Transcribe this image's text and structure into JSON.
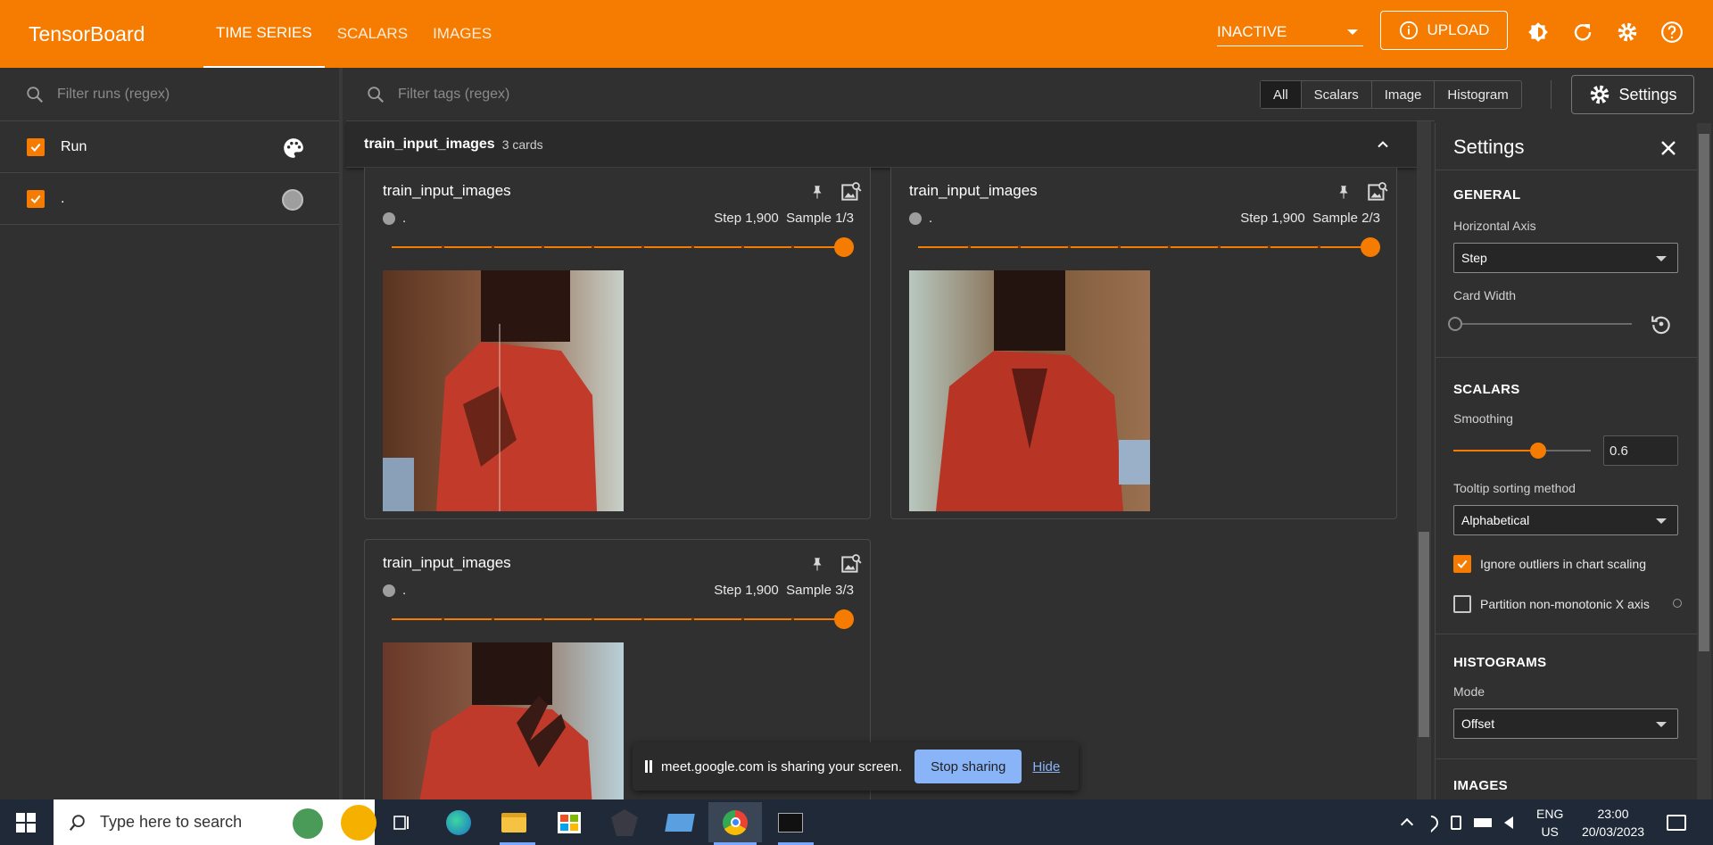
{
  "app": {
    "brand": "TensorBoard",
    "tabs": [
      "TIME SERIES",
      "SCALARS",
      "IMAGES"
    ],
    "active_tab": "TIME SERIES",
    "status_select": "INACTIVE",
    "upload_label": "UPLOAD",
    "accent_color": "#f57c00"
  },
  "left": {
    "filter_placeholder": "Filter runs (regex)",
    "runs": [
      {
        "label": "Run",
        "checked": true,
        "icon": "palette-icon"
      },
      {
        "label": ".",
        "checked": true,
        "icon": "color-dot-icon"
      }
    ]
  },
  "main": {
    "tag_filter_placeholder": "Filter tags (regex)",
    "chips": [
      "All",
      "Scalars",
      "Image",
      "Histogram"
    ],
    "active_chip": "All",
    "settings_button": "Settings",
    "group": {
      "title": "train_input_images",
      "count": "3 cards"
    },
    "cards": [
      {
        "title": "train_input_images",
        "run": ".",
        "step": "Step 1,900",
        "sample": "Sample 1/3"
      },
      {
        "title": "train_input_images",
        "run": ".",
        "step": "Step 1,900",
        "sample": "Sample 2/3"
      },
      {
        "title": "train_input_images",
        "run": ".",
        "step": "Step 1,900",
        "sample": "Sample 3/3"
      }
    ]
  },
  "settings": {
    "title": "Settings",
    "general": {
      "heading": "GENERAL",
      "horizontal_axis_label": "Horizontal Axis",
      "horizontal_axis_value": "Step",
      "card_width_label": "Card Width"
    },
    "scalars": {
      "heading": "SCALARS",
      "smoothing_label": "Smoothing",
      "smoothing_value": "0.6",
      "tooltip_label": "Tooltip sorting method",
      "tooltip_value": "Alphabetical",
      "ignore_outliers_label": "Ignore outliers in chart scaling",
      "ignore_outliers_checked": true,
      "partition_label": "Partition non-monotonic X axis",
      "partition_checked": false
    },
    "histograms": {
      "heading": "HISTOGRAMS",
      "mode_label": "Mode",
      "mode_value": "Offset"
    },
    "images": {
      "heading": "IMAGES"
    }
  },
  "share_bar": {
    "message": "meet.google.com is sharing your screen.",
    "stop_label": "Stop sharing",
    "hide_label": "Hide"
  },
  "taskbar": {
    "search_placeholder": "Type here to search",
    "lang_top": "ENG",
    "lang_bottom": "US",
    "time": "23:00",
    "date": "20/03/2023"
  }
}
